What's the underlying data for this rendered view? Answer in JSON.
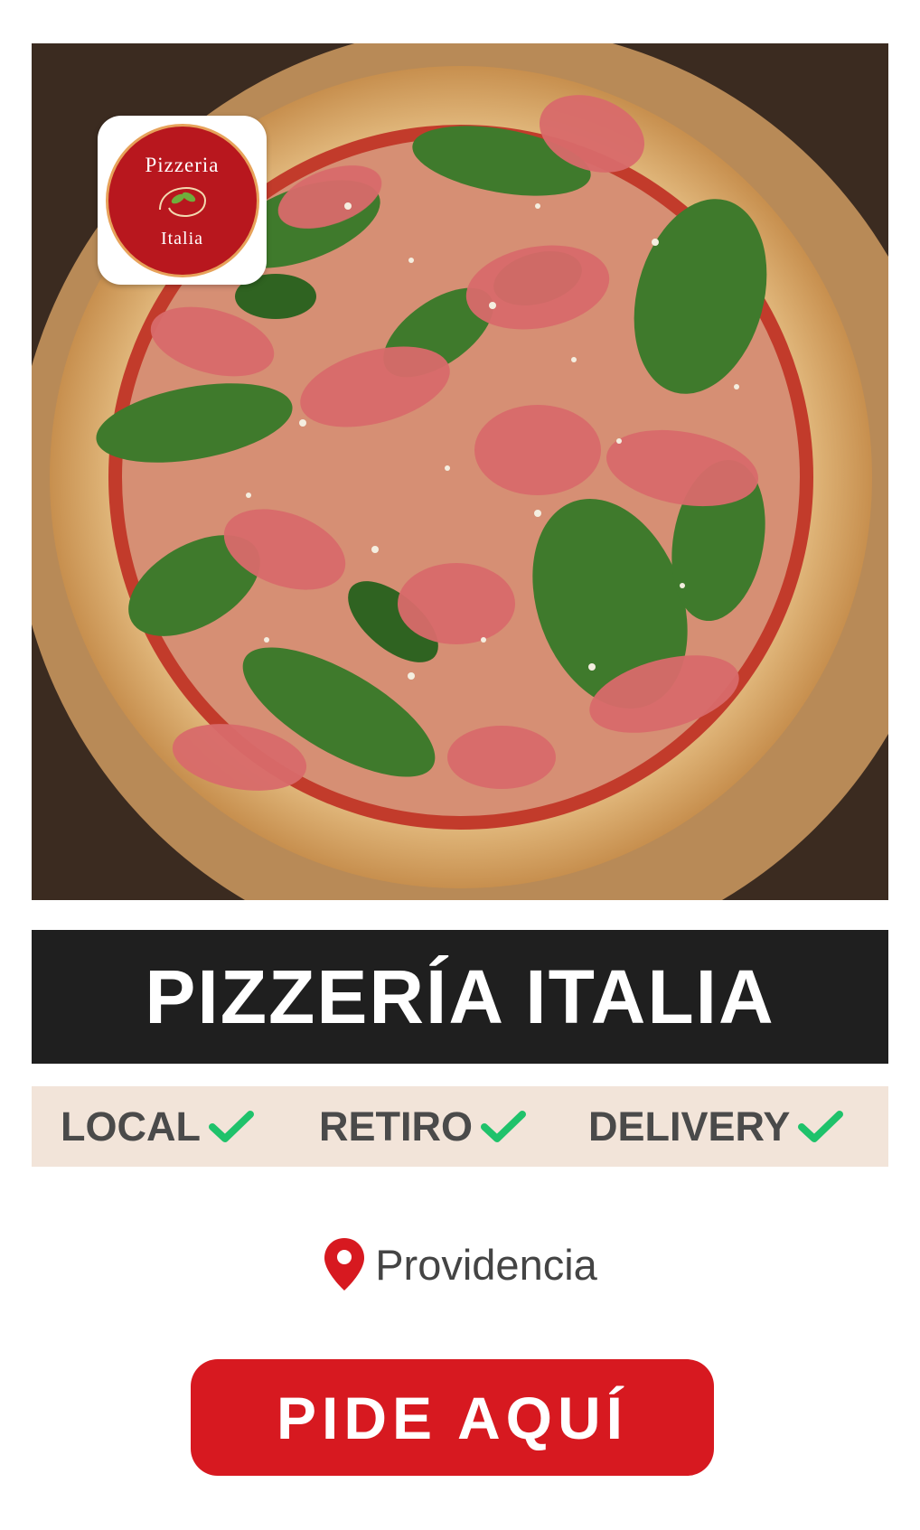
{
  "logo": {
    "top_text": "Pizzeria",
    "bottom_text": "Italia"
  },
  "title": "PIZZERÍA ITALIA",
  "services": [
    {
      "label": "LOCAL",
      "icon": "check-icon"
    },
    {
      "label": "RETIRO",
      "icon": "check-icon"
    },
    {
      "label": "DELIVERY",
      "icon": "check-icon"
    }
  ],
  "location": {
    "icon": "map-pin-icon",
    "text": "Providencia"
  },
  "cta": {
    "label": "PIDE AQUÍ"
  },
  "colors": {
    "brand_red": "#d71920",
    "title_bg": "#1f1f1f",
    "services_bg": "#f2e4d9",
    "check_green": "#1fc26b",
    "text_gray": "#4a4a4a"
  }
}
